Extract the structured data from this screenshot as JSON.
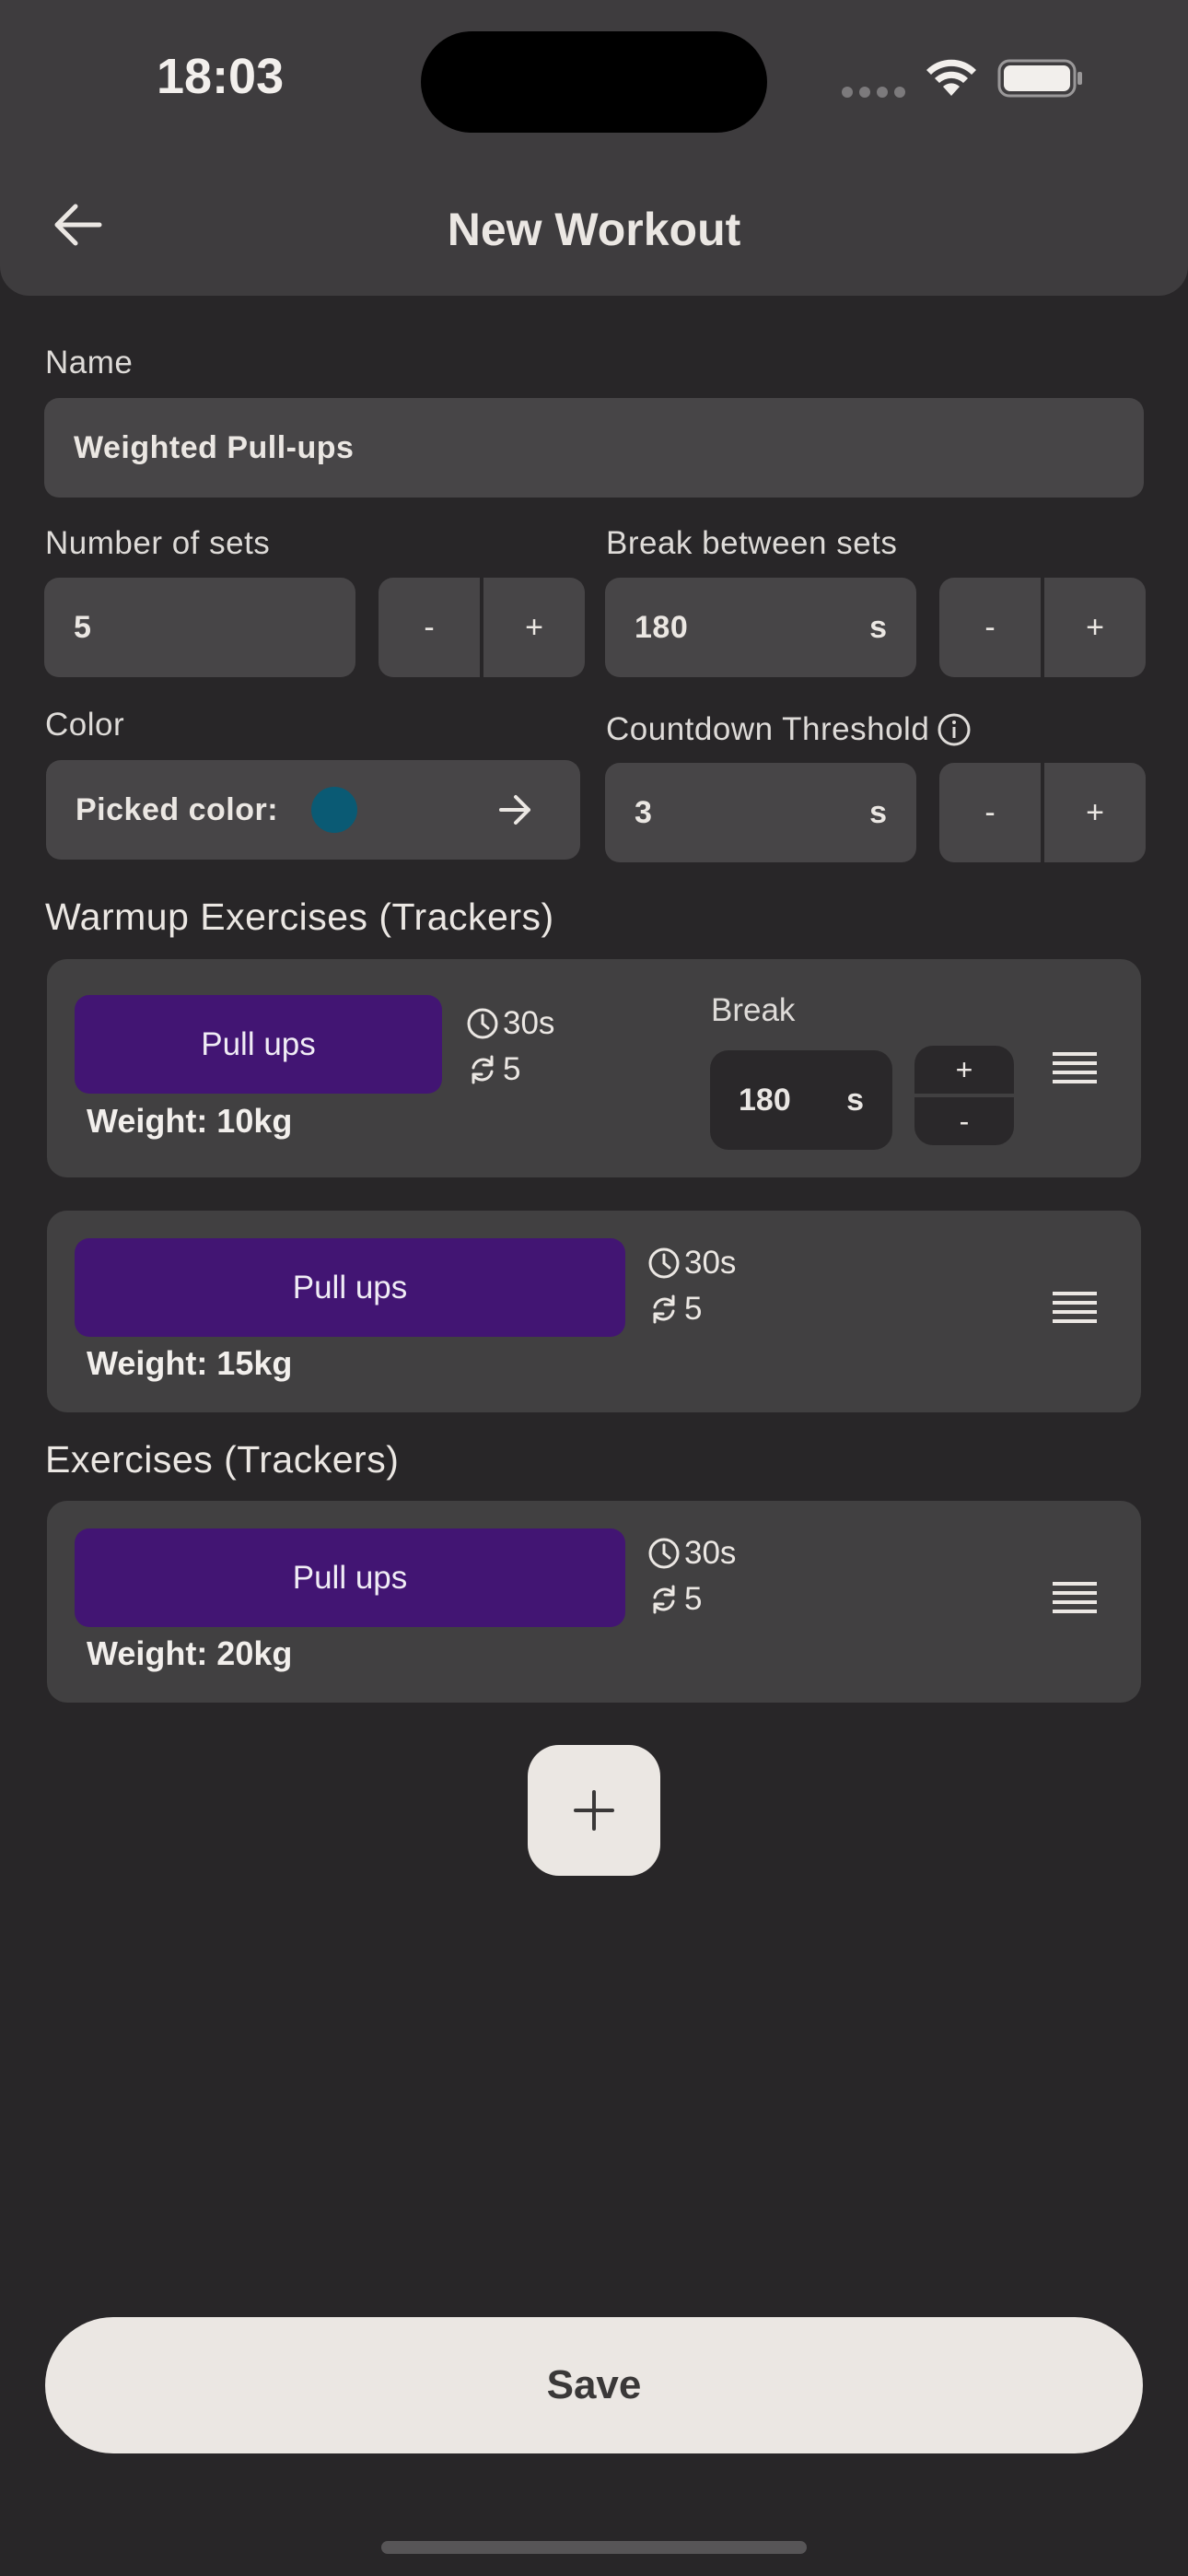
{
  "status_bar": {
    "time": "18:03"
  },
  "header": {
    "title": "New Workout",
    "back_icon": "arrow-left-icon"
  },
  "form": {
    "name_label": "Name",
    "name_value": "Weighted Pull-ups",
    "sets_label": "Number of sets",
    "sets_value": "5",
    "break_label": "Break between sets",
    "break_value": "180",
    "break_unit": "s",
    "color_label": "Color",
    "picked_color_label": "Picked color:",
    "picked_color": "#0a5a74",
    "countdown_label": "Countdown Threshold",
    "countdown_value": "3",
    "countdown_unit": "s",
    "minus": "-",
    "plus": "+"
  },
  "warmup": {
    "title": "Warmup Exercises (Trackers)",
    "items": [
      {
        "name": "Pull ups",
        "duration": "30s",
        "reps": "5",
        "weight": "Weight: 10kg",
        "break_label": "Break",
        "break_value": "180",
        "break_unit": "s"
      },
      {
        "name": "Pull ups",
        "duration": "30s",
        "reps": "5",
        "weight": "Weight: 15kg"
      }
    ]
  },
  "exercises": {
    "title": "Exercises (Trackers)",
    "items": [
      {
        "name": "Pull ups",
        "duration": "30s",
        "reps": "5",
        "weight": "Weight: 20kg"
      }
    ]
  },
  "actions": {
    "save_label": "Save",
    "add_icon": "plus-icon"
  },
  "colors": {
    "background": "#282628",
    "surface": "#474547",
    "exercise_button": "#421573",
    "accent_light": "#ebe7e3"
  }
}
